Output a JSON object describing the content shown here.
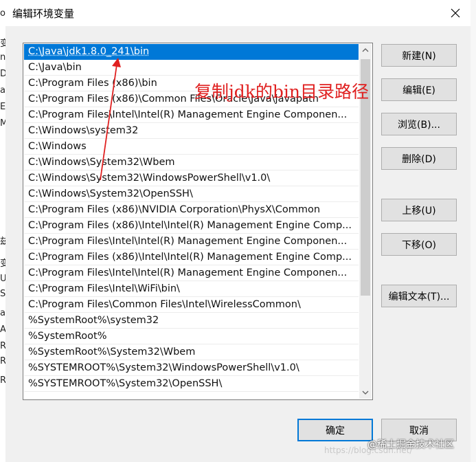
{
  "dialog": {
    "title": "编辑环境变量",
    "ok_label": "确定",
    "cancel_label": "取消"
  },
  "path_entries": [
    "C:\\Java\\jdk1.8.0_241\\bin",
    "C:\\Java\\bin",
    "C:\\Program Files (x86)\\bin",
    "C:\\Program Files (x86)\\Common Files\\Oracle\\Java\\javapath",
    "C:\\Program Files\\Intel\\Intel(R) Management Engine Componen...",
    "C:\\Windows\\system32",
    "C:\\Windows",
    "C:\\Windows\\System32\\Wbem",
    "C:\\Windows\\System32\\WindowsPowerShell\\v1.0\\",
    "C:\\Windows\\System32\\OpenSSH\\",
    "C:\\Program Files (x86)\\NVIDIA Corporation\\PhysX\\Common",
    "C:\\Program Files (x86)\\Intel\\Intel(R) Management Engine Comp...",
    "C:\\Program Files\\Intel\\Intel(R) Management Engine Componen...",
    "C:\\Program Files (x86)\\Intel\\Intel(R) Management Engine Comp...",
    "C:\\Program Files\\Intel\\Intel(R) Management Engine Componen...",
    "C:\\Program Files\\Intel\\WiFi\\bin\\",
    "C:\\Program Files\\Common Files\\Intel\\WirelessCommon\\",
    "%SystemRoot%\\system32",
    "%SystemRoot%",
    "%SystemRoot%\\System32\\Wbem",
    "%SYSTEMROOT%\\System32\\WindowsPowerShell\\v1.0\\",
    "%SYSTEMROOT%\\System32\\OpenSSH\\"
  ],
  "selected_index": 0,
  "buttons": {
    "new": "新建(N)",
    "edit": "编辑(E)",
    "browse": "浏览(B)...",
    "delete": "删除(D)",
    "move_up": "上移(U)",
    "move_down": "下移(O)",
    "edit_text": "编辑文本(T)..."
  },
  "annotation": {
    "text": "复制jdk的bin目录路径",
    "color": "#e02020"
  },
  "background_window": {
    "left_fragments": [
      "o",
      "变",
      "nt",
      "Dr",
      "a",
      "E",
      "M",
      "兹",
      "变",
      "U",
      "S",
      "a",
      "A",
      "R",
      "R",
      "R"
    ]
  },
  "watermark": {
    "text": "@稀土掘金技术社区",
    "url_fragment": "https://blog.csdn.net/"
  },
  "colors": {
    "selection": "#0078d7",
    "focus_border": "#0078d7",
    "annotation": "#e02020"
  }
}
